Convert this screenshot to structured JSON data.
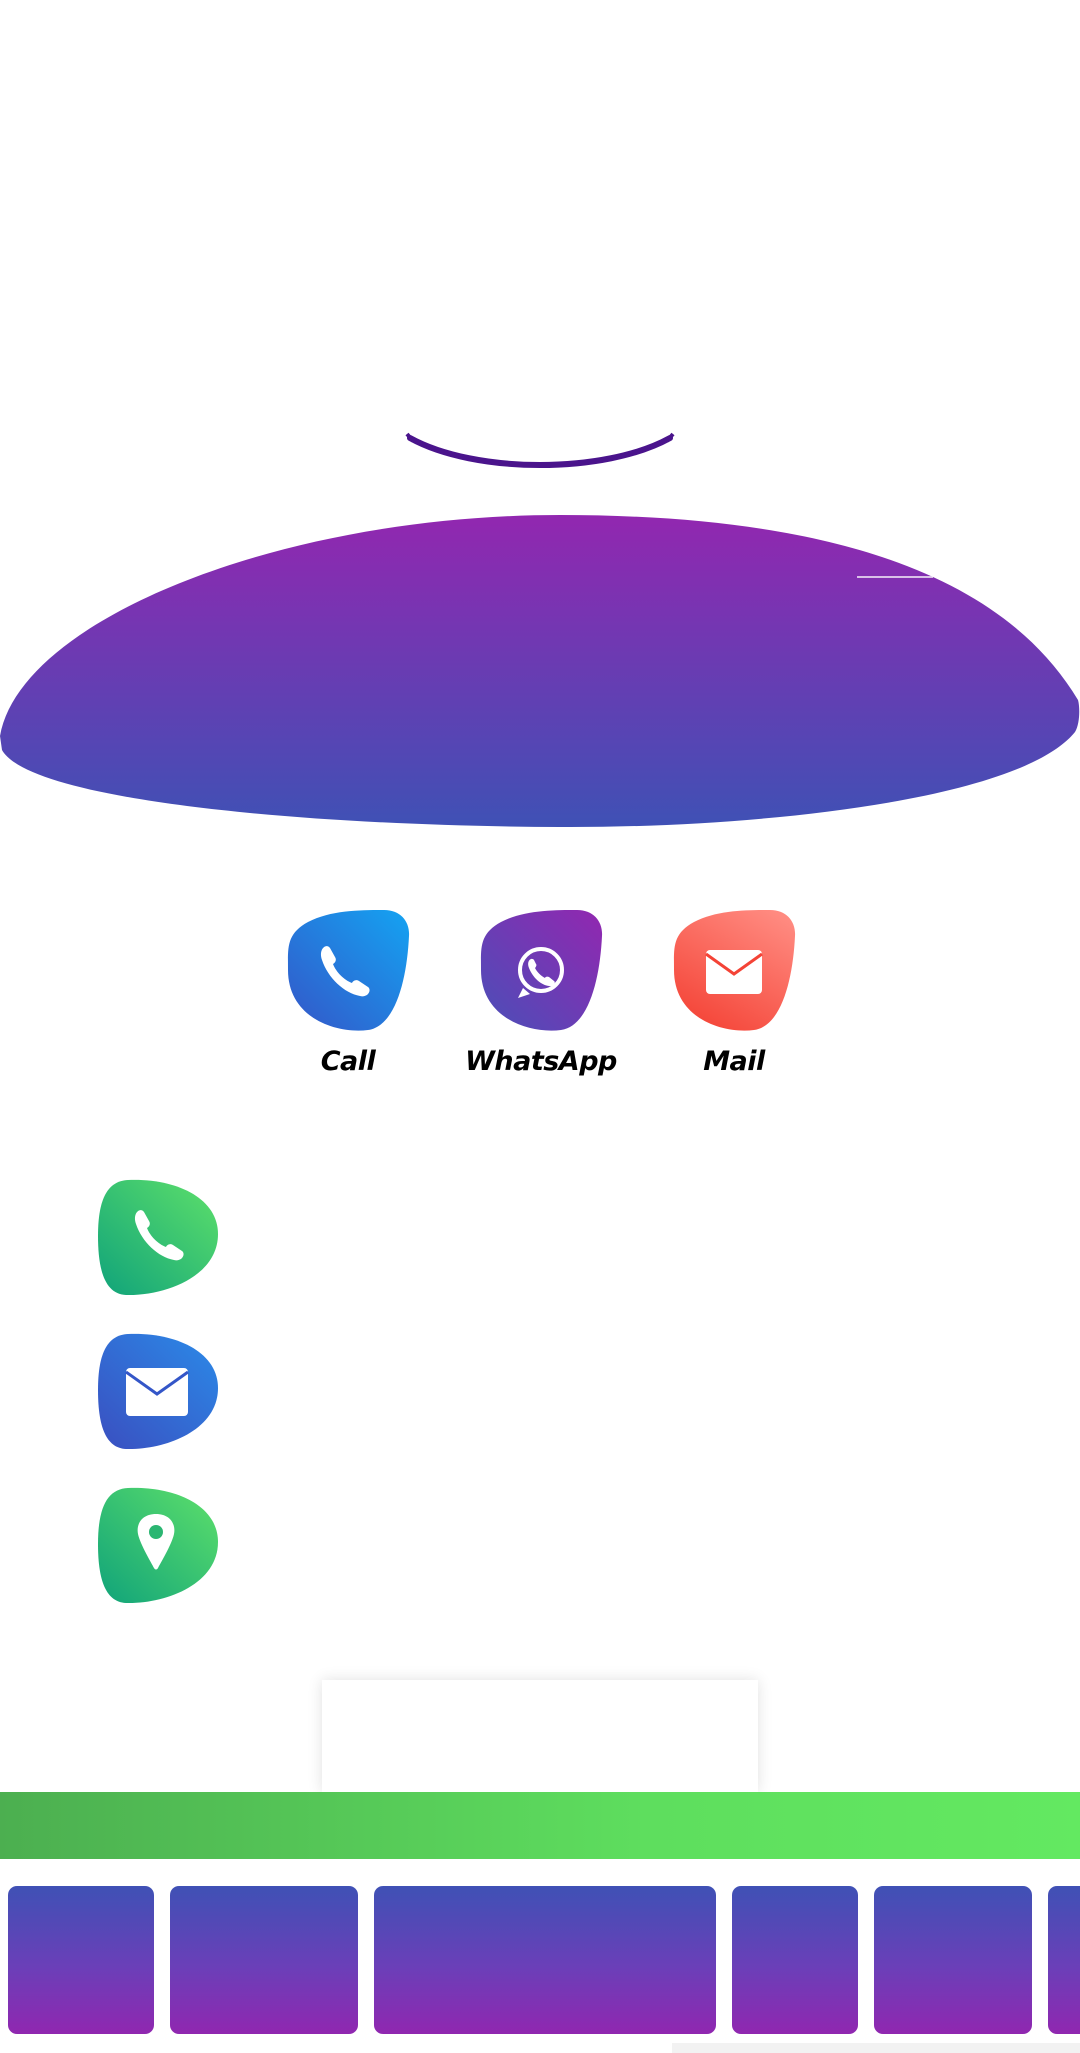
{
  "actions": [
    {
      "id": "call",
      "label": "Call",
      "icon": "phone-icon"
    },
    {
      "id": "whatsapp",
      "label": "WhatsApp",
      "icon": "whatsapp-icon"
    },
    {
      "id": "mail",
      "label": "Mail",
      "icon": "mail-icon"
    }
  ],
  "info_icons": [
    "phone-icon",
    "email-icon",
    "location-pin-icon"
  ],
  "colors": {
    "hero_top": "#9227b0",
    "hero_bottom": "#3f51b5",
    "call_a": "#14a3f2",
    "call_b": "#3456c8",
    "whatsapp_a": "#9227b0",
    "whatsapp_b": "#4a4fb8",
    "mail_a": "#ff8a80",
    "mail_b": "#f44336",
    "green_a": "#10b981",
    "green_b": "#5ee06a",
    "green_bar": "#5ede5e",
    "arc": "#4a148c"
  }
}
